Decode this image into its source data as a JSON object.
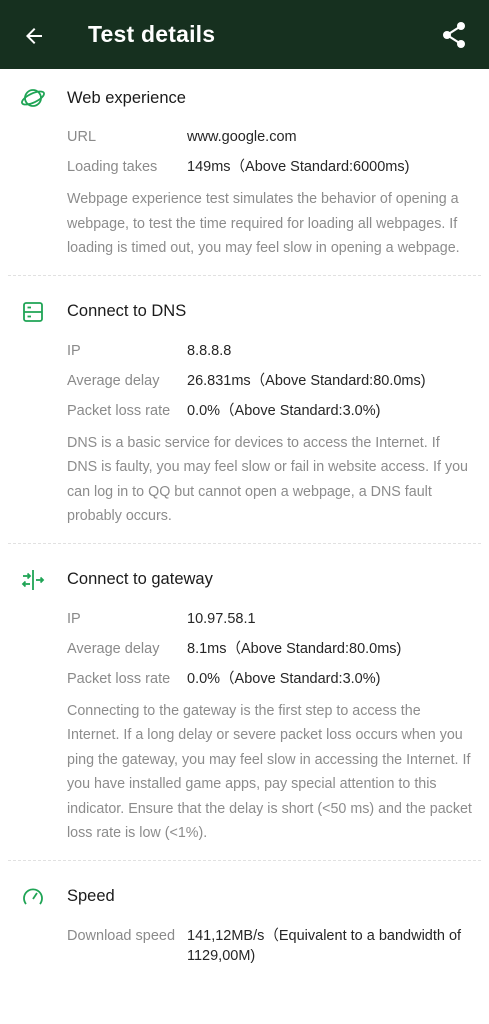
{
  "appbar": {
    "title": "Test details",
    "back_icon": "arrow-back-icon",
    "share_icon": "share-icon",
    "background": "#16301f"
  },
  "accent_color": "#1fa455",
  "sections": [
    {
      "title": "Web experience",
      "icon": "planet-icon",
      "rows": [
        {
          "key": "URL",
          "value": "www.google.com"
        },
        {
          "key": "Loading takes",
          "value": "149ms（Above Standard:6000ms)"
        }
      ],
      "description": "Webpage experience test simulates the behavior of opening a webpage, to test the time required for loading all webpages. If loading is timed out, you may feel slow in opening a webpage."
    },
    {
      "title": "Connect to DNS",
      "icon": "server-icon",
      "rows": [
        {
          "key": "IP",
          "value": "8.8.8.8"
        },
        {
          "key": "Average delay",
          "value": "26.831ms（Above Standard:80.0ms)"
        },
        {
          "key": "Packet loss rate",
          "value": "0.0%（Above Standard:3.0%)"
        }
      ],
      "description": "DNS is a basic service for devices to access the Internet. If DNS is faulty, you may feel slow or fail in website access. If you can log in to QQ but cannot open a webpage, a DNS fault probably occurs."
    },
    {
      "title": "Connect to gateway",
      "icon": "gateway-icon",
      "rows": [
        {
          "key": "IP",
          "value": "10.97.58.1"
        },
        {
          "key": "Average delay",
          "value": "8.1ms（Above Standard:80.0ms)"
        },
        {
          "key": "Packet loss rate",
          "value": "0.0%（Above Standard:3.0%)"
        }
      ],
      "description": "Connecting to the gateway is the first step to access the Internet. If a long delay or severe packet loss occurs when you ping the gateway, you may feel slow in accessing the Internet. If you have installed game apps, pay special attention to this indicator. Ensure that the delay is short (<50 ms) and the packet loss rate is low (<1%)."
    },
    {
      "title": "Speed",
      "icon": "speedometer-icon",
      "rows": [
        {
          "key": "Download speed",
          "value": "141,12MB/s（Equivalent to a bandwidth of 1129,00M)"
        }
      ]
    }
  ]
}
